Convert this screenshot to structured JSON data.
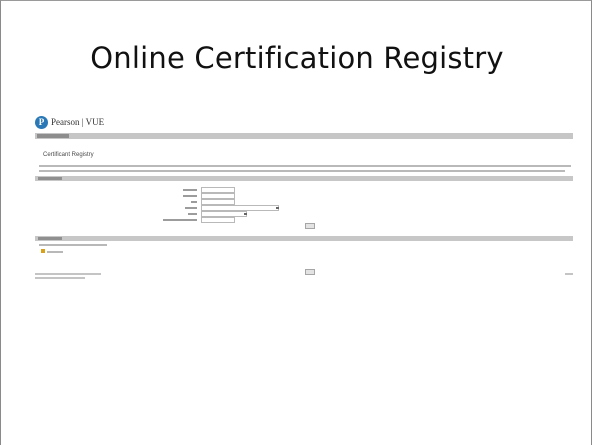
{
  "slide": {
    "title": "Online Certification Registry"
  },
  "screenshot": {
    "brand": "Pearson | VUE",
    "logo_glyph": "P",
    "heading": "Certificant Registry"
  },
  "colors": {
    "brand_blue": "#2a79b6",
    "section_bar": "#c7c7c7",
    "nav_bar": "#c6c6c6",
    "title_text": "#111111"
  },
  "icons": {
    "logo": "pearson-vue-logo-icon",
    "select_caret": "chevron-down-icon",
    "warning": "warning-icon"
  }
}
